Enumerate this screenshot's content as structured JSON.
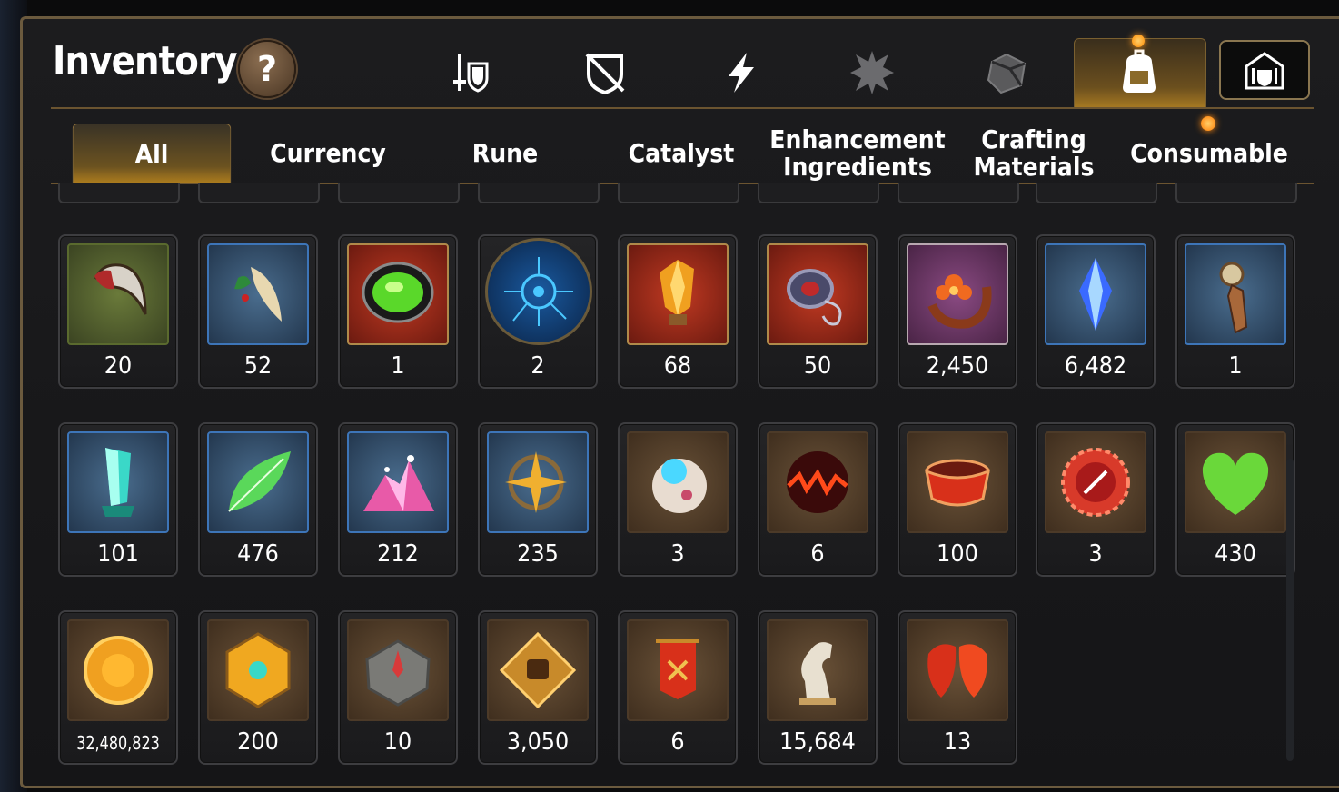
{
  "header": {
    "title": "Inventory",
    "help_label": "?"
  },
  "categories": [
    {
      "name": "gear",
      "icon": "sword-shield-icon",
      "active": false
    },
    {
      "name": "no-gear",
      "icon": "broken-shield-icon",
      "active": false
    },
    {
      "name": "skills",
      "icon": "lightning-icon",
      "active": false
    },
    {
      "name": "crystal",
      "icon": "spiky-crest-icon",
      "active": false
    },
    {
      "name": "cube",
      "icon": "cube-icon",
      "active": false
    },
    {
      "name": "bag",
      "icon": "backpack-icon",
      "active": true
    },
    {
      "name": "guild",
      "icon": "guild-crest-icon",
      "active": false
    }
  ],
  "tabs": [
    {
      "label": "All"
    },
    {
      "label": "Currency"
    },
    {
      "label": "Rune"
    },
    {
      "label": "Catalyst"
    },
    {
      "label": "Enhancement Ingredients"
    },
    {
      "label": "Crafting Materials"
    },
    {
      "label": "Consumable"
    }
  ],
  "items": [
    {
      "icon": "claw-icon",
      "qty": "20"
    },
    {
      "icon": "feather-herb-icon",
      "qty": "52"
    },
    {
      "icon": "green-gem-icon",
      "qty": "1"
    },
    {
      "icon": "blue-rune-disc-icon",
      "qty": "2"
    },
    {
      "icon": "amber-crystal-icon",
      "qty": "68"
    },
    {
      "icon": "coiled-ring-icon",
      "qty": "50"
    },
    {
      "icon": "flower-ring-icon",
      "qty": "2,450"
    },
    {
      "icon": "blue-crystal-icon",
      "qty": "6,482"
    },
    {
      "icon": "dagger-pendant-icon",
      "qty": "1"
    },
    {
      "icon": "teal-crystal-icon",
      "qty": "101"
    },
    {
      "icon": "leaf-icon",
      "qty": "476"
    },
    {
      "icon": "pink-ore-icon",
      "qty": "212"
    },
    {
      "icon": "star-compass-icon",
      "qty": "235"
    },
    {
      "icon": "orb-device-icon",
      "qty": "3"
    },
    {
      "icon": "fire-orb-icon",
      "qty": "6"
    },
    {
      "icon": "red-bracelet-icon",
      "qty": "100"
    },
    {
      "icon": "red-seal-icon",
      "qty": "3"
    },
    {
      "icon": "green-heart-icon",
      "qty": "430"
    },
    {
      "icon": "gold-coin-icon",
      "qty": "32,480,823"
    },
    {
      "icon": "gold-hex-medal-icon",
      "qty": "200"
    },
    {
      "icon": "stone-compass-icon",
      "qty": "10"
    },
    {
      "icon": "fist-emblem-icon",
      "qty": "3,050"
    },
    {
      "icon": "red-banner-icon",
      "qty": "6"
    },
    {
      "icon": "chess-knight-icon",
      "qty": "15,684"
    },
    {
      "icon": "red-leaf-icon",
      "qty": "13"
    }
  ],
  "colors": {
    "accent_gold": "#b2801e",
    "frame": "#6b5a3e",
    "notify": "#ff8a00"
  }
}
